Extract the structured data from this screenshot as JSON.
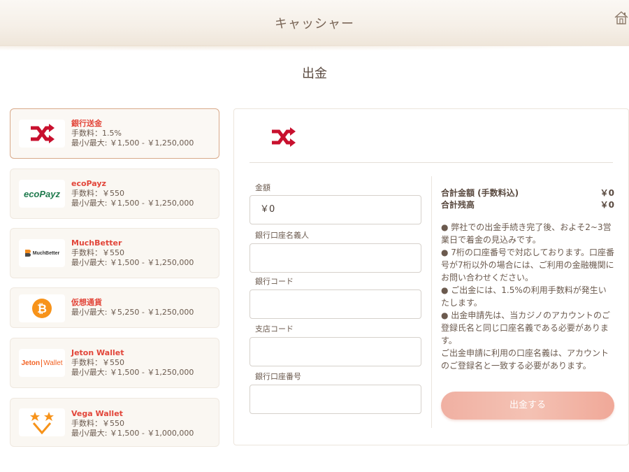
{
  "header": {
    "title": "キャッシャー",
    "home_icon": "home-icon"
  },
  "page": {
    "heading": "出金"
  },
  "methods": [
    {
      "name": "銀行送金",
      "fee": "手数料：1.5%",
      "limits": "最小/最大: ￥1,500 - ￥1,250,000",
      "logo": "bank-transfer-shuffle-icon",
      "selected": true
    },
    {
      "name": "ecoPayz",
      "fee": "手数料：￥550",
      "limits": "最小/最大: ￥1,500 - ￥1,250,000",
      "logo_text": "ecoPayz"
    },
    {
      "name": "MuchBetter",
      "fee": "手数料：￥550",
      "limits": "最小/最大: ￥1,500 - ￥1,250,000",
      "logo_text": "MuchBetter"
    },
    {
      "name": "仮想通貨",
      "limits": "最小/最大: ￥5,250 - ￥1,250,000",
      "logo": "bitcoin-icon"
    },
    {
      "name": "Jeton Wallet",
      "fee": "手数料：￥550",
      "limits": "最小/最大: ￥1,500 - ￥1,250,000",
      "logo_text_a": "Jeton",
      "logo_text_b": "Wallet"
    },
    {
      "name": "Vega Wallet",
      "fee": "手数料：￥550",
      "limits": "最小/最大: ￥1,500 - ￥1,000,000",
      "logo": "vega-stars-icon"
    }
  ],
  "form": {
    "amount_label": "金額",
    "amount_value": "￥0",
    "holder_label": "銀行口座名義人",
    "bank_code_label": "銀行コード",
    "branch_code_label": "支店コード",
    "account_number_label": "銀行口座番号"
  },
  "summary": {
    "total_label": "合計金額 (手数料込)",
    "total_value": "￥0",
    "balance_label": "合計残高",
    "balance_value": "￥0"
  },
  "notes": [
    "● 弊社での出金手続き完了後、およそ2~3営業日で着金の見込みです。",
    "● 7桁の口座番号で対応しております。口座番号が7桁以外の場合には、ご利用の金融機関にお問い合わせください。",
    "● ご出金には、1.5%の利用手数料が発生いたします。",
    "● 出金申請先は、当カジノのアカウントのご登録氏名と同じ口座名義である必要があります。",
    "ご出金申請に利用の口座名義は、アカウントのご登録名と一致する必要があります。"
  ],
  "submit_label": "出金する",
  "colors": {
    "accent_red": "#e2463a",
    "brand_red": "#c8102e",
    "button": "#f2b3a4",
    "text": "#6b5a4e"
  }
}
